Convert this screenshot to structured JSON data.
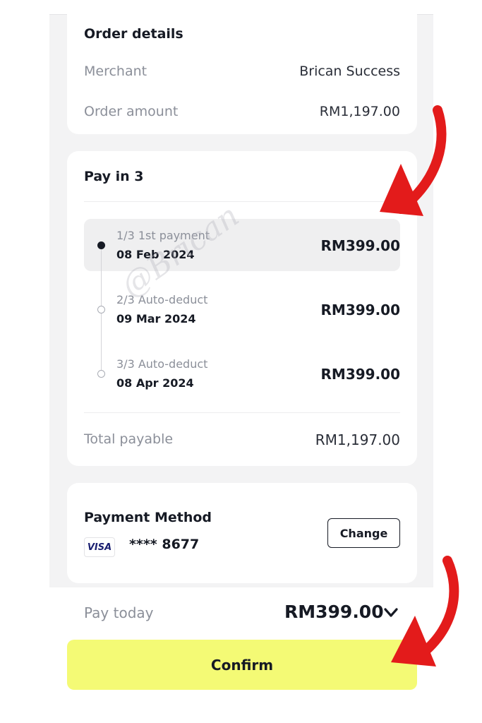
{
  "order_details": {
    "title": "Order details",
    "merchant_label": "Merchant",
    "merchant_value": "Brican Success",
    "amount_label": "Order amount",
    "amount_value": "RM1,197.00"
  },
  "pay_in_3": {
    "title": "Pay in 3",
    "installments": [
      {
        "sub": "1/3 1st payment",
        "date": "08 Feb 2024",
        "amount": "RM399.00"
      },
      {
        "sub": "2/3 Auto-deduct",
        "date": "09 Mar 2024",
        "amount": "RM399.00"
      },
      {
        "sub": "3/3 Auto-deduct",
        "date": "08 Apr 2024",
        "amount": "RM399.00"
      }
    ],
    "total_label": "Total payable",
    "total_value": "RM1,197.00"
  },
  "payment_method": {
    "title": "Payment Method",
    "card_brand": "VISA",
    "card_number": "**** 8677",
    "change_label": "Change"
  },
  "footer": {
    "pay_today_label": "Pay today",
    "pay_today_value": "RM399.00",
    "confirm_label": "Confirm"
  },
  "watermark": "@Brican",
  "colors": {
    "accent": "#f4fa75",
    "arrow": "#e31b1b",
    "background": "#f3f3f4"
  },
  "icons": [
    "chevron-down-icon",
    "visa-logo-icon",
    "red-arrow-annotation"
  ]
}
